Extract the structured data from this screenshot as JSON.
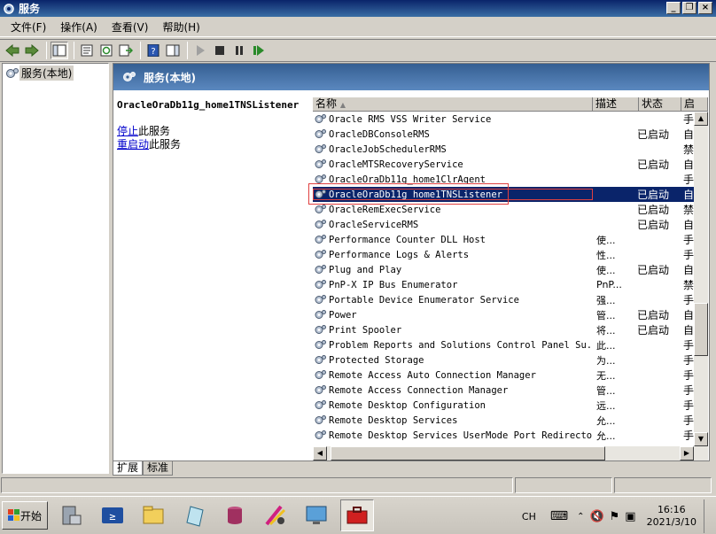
{
  "window": {
    "title": "服务"
  },
  "menu": [
    "文件(F)",
    "操作(A)",
    "查看(V)",
    "帮助(H)"
  ],
  "tree": {
    "root": "服务(本地)"
  },
  "panel": {
    "header": "服务(本地)",
    "selected_service": "OracleOraDb11g_home1TNSListener",
    "stop_link": "停止",
    "stop_suffix": "此服务",
    "restart_link": "重启动",
    "restart_suffix": "此服务"
  },
  "columns": {
    "name": "名称",
    "desc": "描述",
    "status": "状态",
    "start": "启"
  },
  "services": [
    {
      "name": "Oracle RMS VSS Writer Service",
      "desc": "",
      "status": "",
      "start": "手"
    },
    {
      "name": "OracleDBConsoleRMS",
      "desc": "",
      "status": "已启动",
      "start": "自"
    },
    {
      "name": "OracleJobSchedulerRMS",
      "desc": "",
      "status": "",
      "start": "禁"
    },
    {
      "name": "OracleMTSRecoveryService",
      "desc": "",
      "status": "已启动",
      "start": "自"
    },
    {
      "name": "OracleOraDb11g_home1ClrAgent",
      "desc": "",
      "status": "",
      "start": "手"
    },
    {
      "name": "OracleOraDb11g_home1TNSListener",
      "desc": "",
      "status": "已启动",
      "start": "自",
      "selected": true
    },
    {
      "name": "OracleRemExecService",
      "desc": "",
      "status": "已启动",
      "start": "禁"
    },
    {
      "name": "OracleServiceRMS",
      "desc": "",
      "status": "已启动",
      "start": "自"
    },
    {
      "name": "Performance Counter DLL Host",
      "desc": "使...",
      "status": "",
      "start": "手"
    },
    {
      "name": "Performance Logs & Alerts",
      "desc": "性...",
      "status": "",
      "start": "手"
    },
    {
      "name": "Plug and Play",
      "desc": "使...",
      "status": "已启动",
      "start": "自"
    },
    {
      "name": "PnP-X IP Bus Enumerator",
      "desc": "PnP...",
      "status": "",
      "start": "禁"
    },
    {
      "name": "Portable Device Enumerator Service",
      "desc": "强...",
      "status": "",
      "start": "手"
    },
    {
      "name": "Power",
      "desc": "管...",
      "status": "已启动",
      "start": "自"
    },
    {
      "name": "Print Spooler",
      "desc": "将...",
      "status": "已启动",
      "start": "自"
    },
    {
      "name": "Problem Reports and Solutions Control Panel Su...",
      "desc": "此...",
      "status": "",
      "start": "手"
    },
    {
      "name": "Protected Storage",
      "desc": "为...",
      "status": "",
      "start": "手"
    },
    {
      "name": "Remote Access Auto Connection Manager",
      "desc": "无...",
      "status": "",
      "start": "手"
    },
    {
      "name": "Remote Access Connection Manager",
      "desc": "管...",
      "status": "",
      "start": "手"
    },
    {
      "name": "Remote Desktop Configuration",
      "desc": "远...",
      "status": "",
      "start": "手"
    },
    {
      "name": "Remote Desktop Services",
      "desc": "允...",
      "status": "",
      "start": "手"
    },
    {
      "name": "Remote Desktop Services UserMode Port Redirector",
      "desc": "允...",
      "status": "",
      "start": "手"
    }
  ],
  "tabs": [
    "扩展",
    "标准"
  ],
  "taskbar": {
    "start": "开始",
    "lang": "CH",
    "time": "16:16",
    "date": "2021/3/10"
  }
}
